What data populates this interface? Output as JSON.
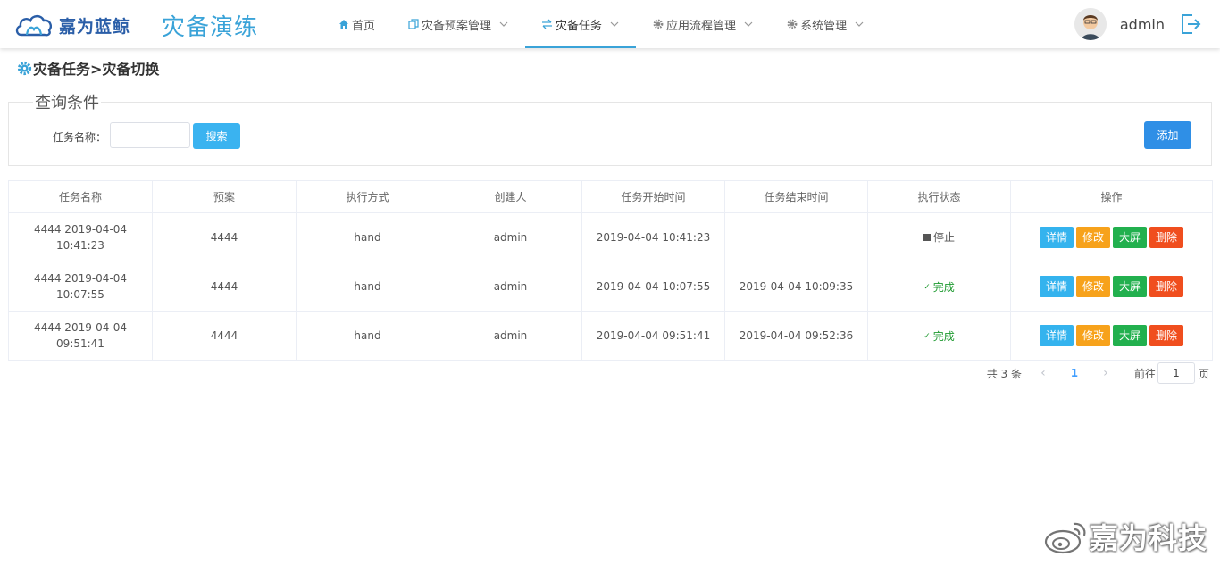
{
  "header": {
    "logo_text": "嘉为蓝鲸",
    "app_title": "灾备演练",
    "nav": [
      {
        "label": "首页",
        "icon": "home-icon",
        "dropdown": false
      },
      {
        "label": "灾备预案管理",
        "icon": "copy-icon",
        "dropdown": true
      },
      {
        "label": "灾备任务",
        "icon": "swap-icon",
        "dropdown": true,
        "active": true
      },
      {
        "label": "应用流程管理",
        "icon": "gear-icon",
        "dropdown": true
      },
      {
        "label": "系统管理",
        "icon": "gear-icon",
        "dropdown": true
      }
    ],
    "username": "admin"
  },
  "breadcrumb": "灾备任务>灾备切换",
  "query": {
    "legend": "查询条件",
    "task_name_label": "任务名称：",
    "task_name_value": "",
    "search_label": "搜索",
    "add_label": "添加"
  },
  "table": {
    "columns": [
      "任务名称",
      "预案",
      "执行方式",
      "创建人",
      "任务开始时间",
      "任务结束时间",
      "执行状态",
      "操作"
    ],
    "rows": [
      {
        "name": "4444 2019-04-04 10:41:23",
        "plan": "4444",
        "method": "hand",
        "creator": "admin",
        "start": "2019-04-04 10:41:23",
        "end": "",
        "status": "停止",
        "status_type": "stopped"
      },
      {
        "name": "4444 2019-04-04 10:07:55",
        "plan": "4444",
        "method": "hand",
        "creator": "admin",
        "start": "2019-04-04 10:07:55",
        "end": "2019-04-04 10:09:35",
        "status": "完成",
        "status_type": "done"
      },
      {
        "name": "4444 2019-04-04 09:51:41",
        "plan": "4444",
        "method": "hand",
        "creator": "admin",
        "start": "2019-04-04 09:51:41",
        "end": "2019-04-04 09:52:36",
        "status": "完成",
        "status_type": "done"
      }
    ],
    "actions": {
      "detail": "详情",
      "edit": "修改",
      "screen": "大屏",
      "delete": "删除"
    }
  },
  "pagination": {
    "total": "共 3 条",
    "current_page": "1",
    "goto_label": "前往",
    "goto_value": "1",
    "page_suffix": "页"
  },
  "watermark": "嘉为科技",
  "colors": {
    "accent": "#3aa3d8",
    "detail": "#34b3ee",
    "edit": "#f7a21b",
    "screen": "#22b04e",
    "delete": "#f04e1e",
    "add": "#2f8fe6",
    "done": "#1e9a30"
  }
}
